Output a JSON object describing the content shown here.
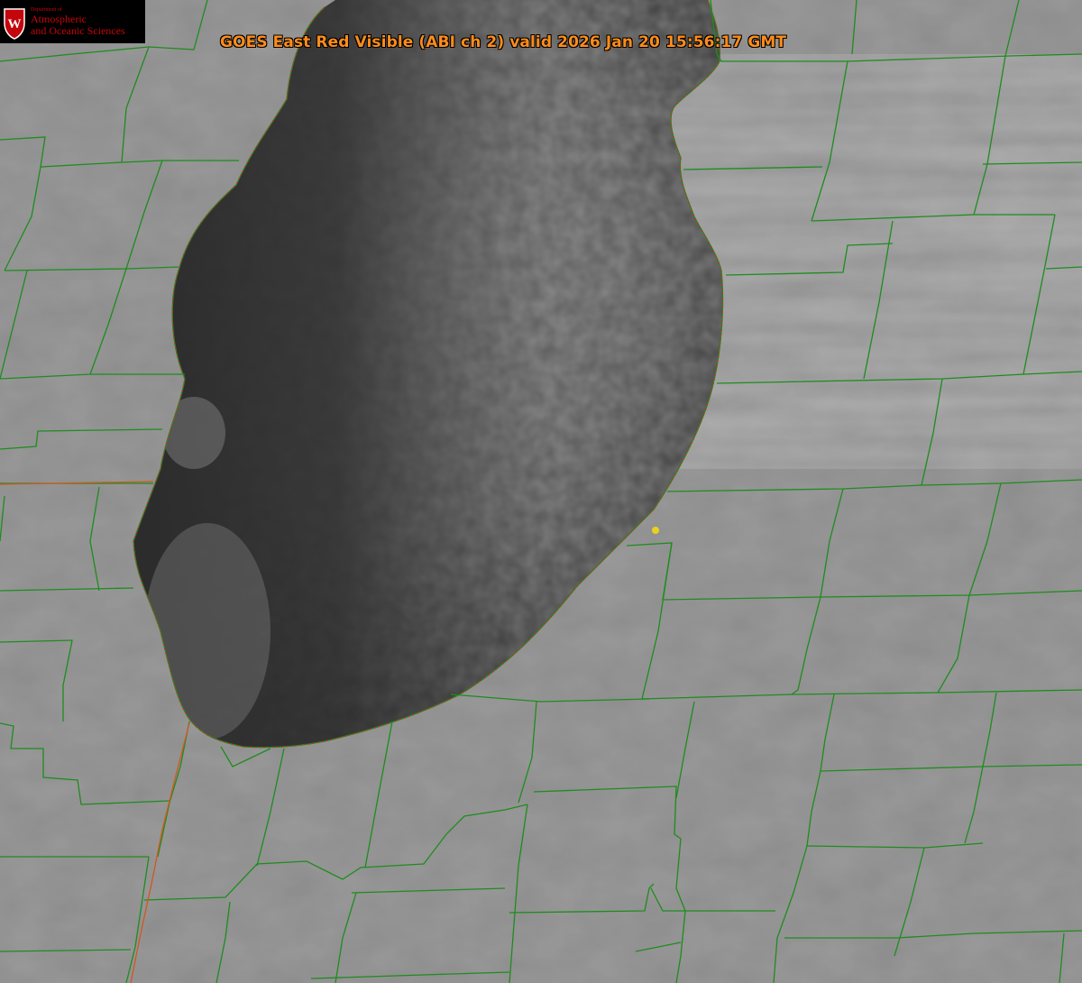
{
  "header": {
    "title": "GOES East Red Visible (ABI ch 2) valid 2026 Jan 20 15:56:17 GMT"
  },
  "logo": {
    "letter": "W",
    "dept_line": "Department of",
    "line1": "Atmospheric",
    "line2": "and Oceanic Sciences"
  },
  "colors": {
    "title": "#ff8c1a",
    "logo_text": "#c5050c",
    "logo_shield": "#c5050c",
    "county_lines": "#1e8c1e",
    "state_line": "#d2571e",
    "lake_shoreline_dotted": "#e02020",
    "marker": "#e8d21e",
    "land": "#8c8c8c",
    "lake_water": "#3a3a3a"
  },
  "icons": {
    "logo_shield": "uw-crest-icon",
    "point_marker": "location-dot-icon"
  }
}
